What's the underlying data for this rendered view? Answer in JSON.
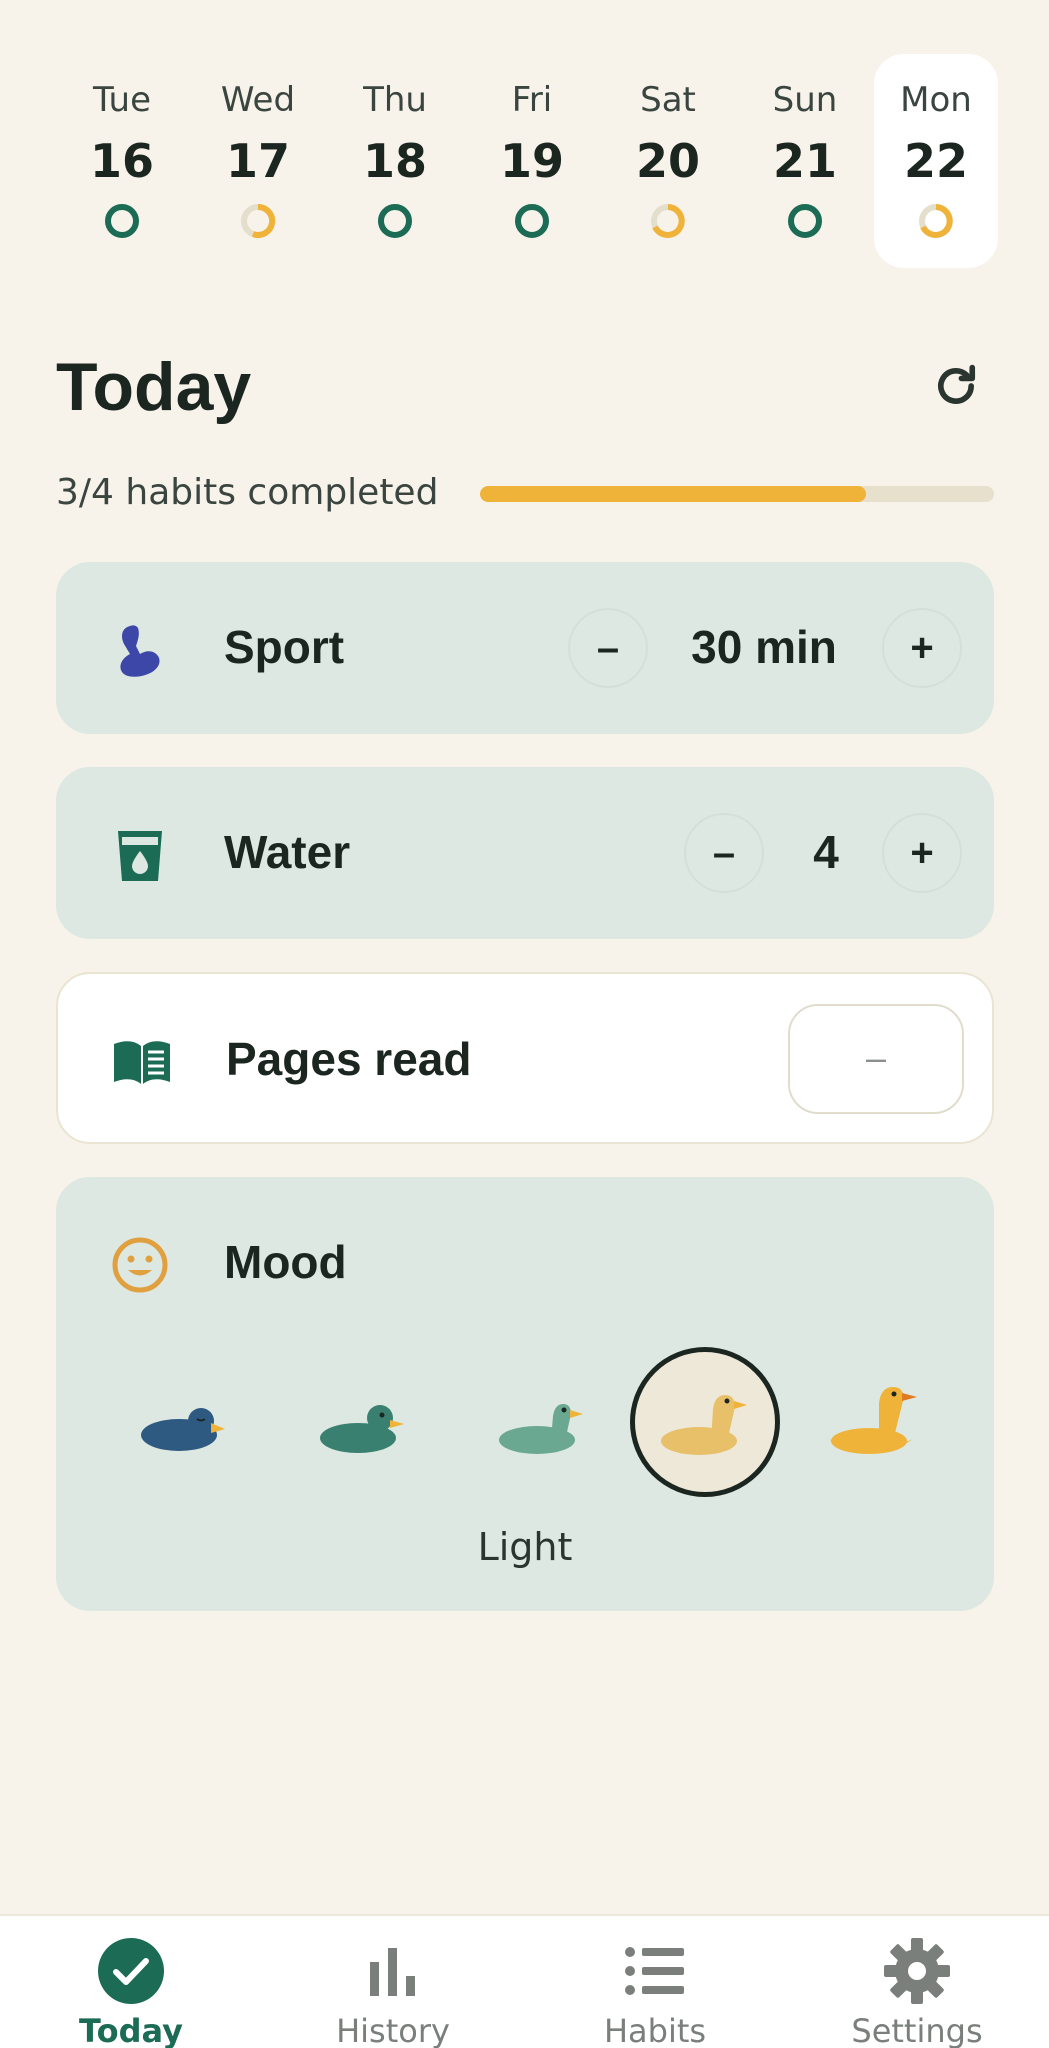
{
  "week": [
    {
      "name": "Tue",
      "num": "16",
      "status": "complete"
    },
    {
      "name": "Wed",
      "num": "17",
      "status": "partial"
    },
    {
      "name": "Thu",
      "num": "18",
      "status": "complete"
    },
    {
      "name": "Fri",
      "num": "19",
      "status": "complete"
    },
    {
      "name": "Sat",
      "num": "20",
      "status": "partial"
    },
    {
      "name": "Sun",
      "num": "21",
      "status": "complete"
    },
    {
      "name": "Mon",
      "num": "22",
      "status": "partial"
    }
  ],
  "header": {
    "title": "Today",
    "refresh_icon": "refresh-icon"
  },
  "progress": {
    "label": "3/4 habits completed",
    "fraction": 0.75
  },
  "habits": {
    "sport": {
      "name": "Sport",
      "value": "30 min",
      "minus": "–",
      "plus": "+",
      "icon": "flexed-arm-icon"
    },
    "water": {
      "name": "Water",
      "value": "4",
      "minus": "–",
      "plus": "+",
      "icon": "water-glass-icon"
    },
    "pages": {
      "name": "Pages read",
      "value": "–",
      "icon": "open-book-icon"
    },
    "mood": {
      "name": "Mood",
      "selected_label": "Light",
      "icon": "smiley-icon",
      "selected_index": 3
    }
  },
  "nav": {
    "today": "Today",
    "history": "History",
    "habits": "Habits",
    "settings": "Settings"
  },
  "colors": {
    "background": "#F7F3EA",
    "card_green": "#DCE8E1",
    "accent_green": "#1B6B55",
    "accent_yellow": "#F0B33A",
    "sport_blue": "#3D47A8",
    "mood_orange": "#E0A040"
  }
}
